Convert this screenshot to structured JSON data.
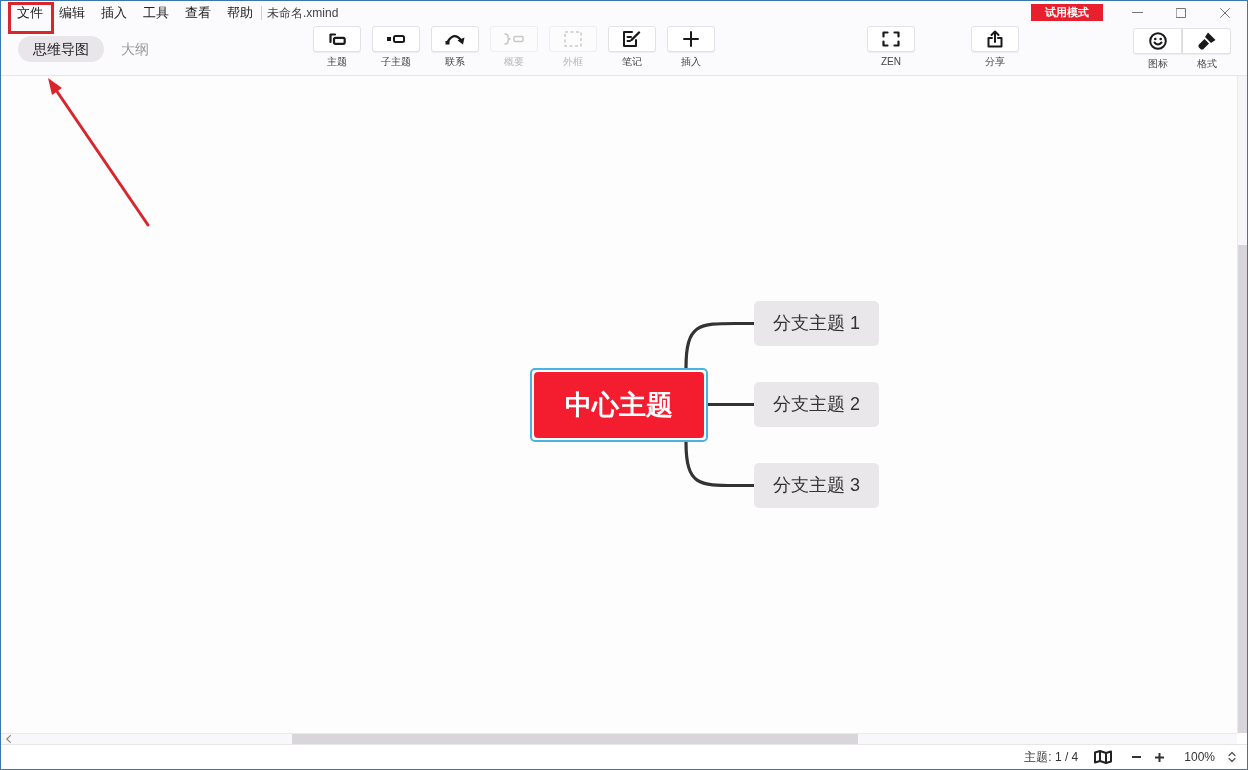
{
  "window": {
    "title": "未命名.xmind",
    "badge": "试用模式"
  },
  "menu": [
    "文件",
    "编辑",
    "插入",
    "工具",
    "查看",
    "帮助"
  ],
  "view_tabs": [
    {
      "label": "思维导图",
      "selected": true
    },
    {
      "label": "大纲",
      "selected": false
    }
  ],
  "toolbar": [
    {
      "label": "主题",
      "kind": "topic",
      "disabled": false
    },
    {
      "label": "子主题",
      "kind": "subtopic",
      "disabled": false
    },
    {
      "label": "联系",
      "kind": "relationship",
      "disabled": false
    },
    {
      "label": "概要",
      "kind": "summary",
      "disabled": true
    },
    {
      "label": "外框",
      "kind": "boundary",
      "disabled": true
    },
    {
      "label": "笔记",
      "kind": "note",
      "disabled": false
    },
    {
      "label": "插入",
      "kind": "insert",
      "disabled": false
    }
  ],
  "toolbar_right": [
    {
      "label": "ZEN",
      "kind": "zen"
    },
    {
      "label": "分享",
      "kind": "share"
    }
  ],
  "panel_toggles": [
    {
      "label": "图标",
      "kind": "icons"
    },
    {
      "label": "格式",
      "kind": "format"
    }
  ],
  "mind_map": {
    "central": {
      "label": "中心主题",
      "selected": true
    },
    "branches": [
      {
        "label": "分支主题 1"
      },
      {
        "label": "分支主题 2"
      },
      {
        "label": "分支主题 3"
      }
    ]
  },
  "status_bar": {
    "topic_count": "主题: 1 / 4",
    "zoom": "100%"
  },
  "callouts": {
    "highlight_box": true,
    "arrow": true
  }
}
